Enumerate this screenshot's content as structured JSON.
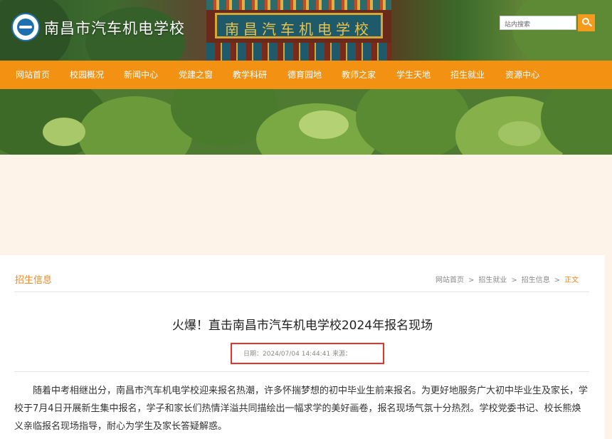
{
  "header": {
    "site_title": "南昌市汽车机电学校",
    "plaque_text": "南昌汽车机电学校",
    "search": {
      "placeholder": "站内搜索"
    }
  },
  "nav": {
    "items": [
      "网站首页",
      "校园概况",
      "新闻中心",
      "党建之窗",
      "教学科研",
      "德育园地",
      "教师之家",
      "学生天地",
      "招生就业",
      "资源中心"
    ]
  },
  "section": {
    "title": "招生信息"
  },
  "breadcrumb": {
    "items": [
      "网站首页",
      "招生就业",
      "招生信息"
    ],
    "current": "正文",
    "separator": ">"
  },
  "article": {
    "title": "火爆！直击南昌市汽车机电学校2024年报名现场",
    "meta": "日期：2024/07/04 14:44:41 来源：",
    "body": "随着中考相继出分，南昌市汽车机电学校迎来报名热潮，许多怀揣梦想的初中毕业生前来报名。为更好地服务广大初中毕业生及家长，学校于7月4日开展新生集中报名，学子和家长们热情洋溢共同描绘出一幅求学的美好画卷，报名现场气氛十分热烈。学校党委书记、校长熊焕义亲临报名现场指导，耐心为学生及家长答疑解惑。"
  },
  "colors": {
    "accent": "#f39112",
    "highlight_border": "#e5352b",
    "link": "#e9892a"
  }
}
